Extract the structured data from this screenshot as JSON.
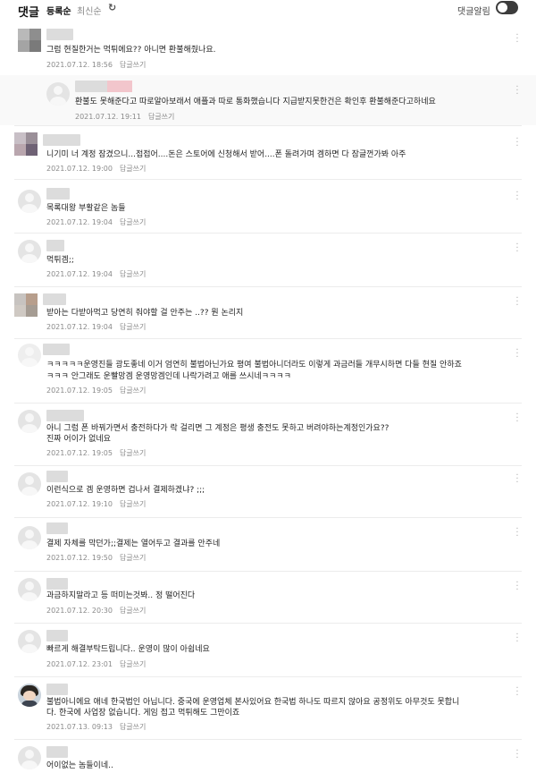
{
  "header": {
    "title": "댓글",
    "sort_registered": "등록순",
    "sort_latest": "최신순",
    "refresh_icon": "refresh-icon",
    "alarm_label": "댓글알림",
    "alarm_on": false
  },
  "reply_label": "답글쓰기",
  "comments": [
    {
      "lines": [
        "그럼 현질한거는 먹튀에요?? 아니면 환불해줬나요."
      ],
      "date": "2021.07.12. 18:56"
    },
    {
      "lines": [
        "환불도 못해준다고 따로알아보래서 애플과 따로 통화했습니다 지급받지못한건은 확인후 환불해준다고하네요"
      ],
      "date": "2021.07.12. 19:11"
    },
    {
      "lines": [
        "니기미 너 계정 잠겼으니...접접어....돈은 스토어에 신청해서 받어....폰 돌려가며 겜하면 다 잠글껀가봐 아주"
      ],
      "date": "2021.07.12. 19:00"
    },
    {
      "lines": [
        "목록대왕 부활같은 놈들"
      ],
      "date": "2021.07.12. 19:04"
    },
    {
      "lines": [
        "먹튀겜;;"
      ],
      "date": "2021.07.12. 19:04"
    },
    {
      "lines": [
        "받아는 다받아먹고 당연히 줘야할 걸 안주는 ..?? 뭔 논리지"
      ],
      "date": "2021.07.12. 19:04"
    },
    {
      "lines": [
        "ㅋㅋㅋㅋㅋ운영진들 광도좋네 이거 엄연히 불법아닌가요 평여 불법아니더라도 이렇게 과금러들 개무시하면 다들 현질 안하죠",
        "ㅋㅋㅋ 안그래도 운빨망겜 운영망겜인데 나락가려고 애를 쓰시네ㅋㅋㅋㅋ"
      ],
      "date": "2021.07.12. 19:05"
    },
    {
      "lines": [
        "아니 그럼 폰 바꿔가면서 충전하다가 락 걸리면 그 계정은 평생 충전도 못하고 버려야하는계정인가요??",
        "진짜 어이가 없네요"
      ],
      "date": "2021.07.12. 19:05"
    },
    {
      "lines": [
        "이런식으로 겜 운영하면 겁나서 결제하겠냐? ;;;"
      ],
      "date": "2021.07.12. 19:10"
    },
    {
      "lines": [
        "결제 자체를 막던가;;결제는 열어두고 결과를 안주네"
      ],
      "date": "2021.07.12. 19:50"
    },
    {
      "lines": [
        "과금하지말라고 등 떠미는것봐.. 정 떨어진다"
      ],
      "date": "2021.07.12. 20:30"
    },
    {
      "lines": [
        "빠르게 해결부탁드립니다.. 운영이 많이 아쉽네요"
      ],
      "date": "2021.07.12. 23:01"
    },
    {
      "lines": [
        "불법아니에요 애네 한국법인 아닙니다. 중국에 운영업체 본사있어요 한국법 하나도 따르지 않아요 공정위도 아무것도 못합니",
        "다. 한국에 사업장 없습니다. 게임 접고 먹튀해도 그만이죠"
      ],
      "date": "2021.07.13. 09:13"
    },
    {
      "lines": [
        "어이없는 놈들이네.."
      ],
      "date": ""
    }
  ],
  "colors": {
    "mosaic_1": [
      "#b9b9b9",
      "#8e8e8e",
      "#a4a4a4",
      "#7a7a7a"
    ],
    "mosaic_2": [
      "#c8bfc6",
      "#9a8f98",
      "#b9a6ae",
      "#6f6275"
    ],
    "mosaic_3": [
      "#c7c3c0",
      "#b79e8c",
      "#cfc9c3",
      "#a59c93"
    ],
    "nick_pink": "#f2c6cc"
  }
}
